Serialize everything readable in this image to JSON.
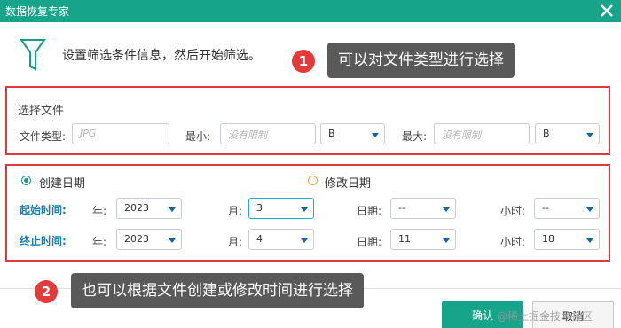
{
  "window": {
    "title": "数据恢复专家"
  },
  "header": {
    "text": "设置筛选条件信息，然后开始筛选。"
  },
  "annotations": [
    {
      "number": "1",
      "text": "可以对文件类型进行选择"
    },
    {
      "number": "2",
      "text": "也可以根据文件创建或修改时间进行选择"
    }
  ],
  "file_section": {
    "title": "选择文件",
    "type_label": "文件类型:",
    "type_placeholder": "JPG",
    "min_label": "最小:",
    "min_placeholder": "没有限制",
    "min_unit": "B",
    "max_label": "最大:",
    "max_placeholder": "没有限制",
    "max_unit": "B"
  },
  "date_section": {
    "created_label": "创建日期",
    "modified_label": "修改日期",
    "selected": "created",
    "start": {
      "label": "起始时间:",
      "year_label": "年:",
      "year": "2023",
      "month_label": "月:",
      "month": "3",
      "day_label": "日期:",
      "day": "--",
      "hour_label": "小时:",
      "hour": "--"
    },
    "end": {
      "label": "终止时间:",
      "year_label": "年:",
      "year": "2023",
      "month_label": "月:",
      "month": "4",
      "day_label": "日期:",
      "day": "11",
      "hour_label": "小时:",
      "hour": "18"
    }
  },
  "buttons": {
    "ok": "确认",
    "cancel": "取消"
  },
  "watermark": "@稀土掘金技术社区",
  "colors": {
    "titlebar": "#16a58a",
    "highlight": "#e03a3a",
    "callout": "#595959"
  }
}
